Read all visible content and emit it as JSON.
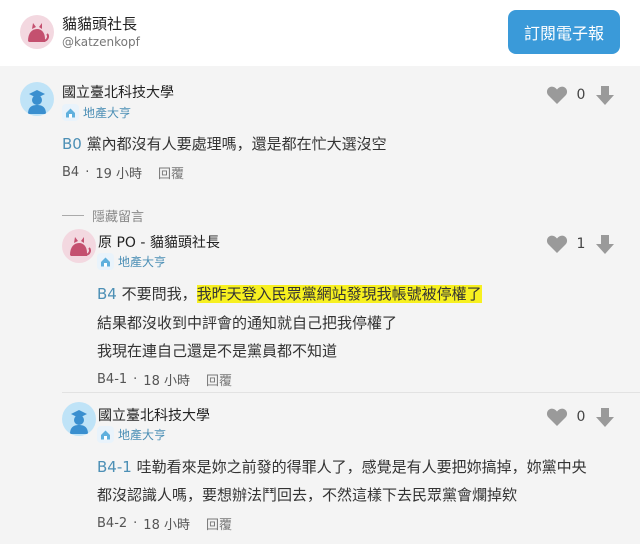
{
  "header": {
    "name": "貓貓頭社長",
    "handle": "@katzenkopf",
    "subscribe_label": "訂閱電子報"
  },
  "comments": [
    {
      "author": "國立臺北科技大學",
      "badge": "地產大亨",
      "floor_ref": "B0",
      "text": "黨內都沒有人要處理嗎，還是都在忙大選沒空",
      "floor": "B4",
      "time": "19 小時",
      "reply": "回覆",
      "likes": "0"
    }
  ],
  "hidden_label": "隱藏留言",
  "replies": [
    {
      "author": "原 PO - 貓貓頭社長",
      "badge": "地產大亨",
      "floor_ref": "B4",
      "text_pre": "不要問我，",
      "text_highlight": "我昨天登入民眾黨網站發現我帳號被停權了",
      "line2": "結果都沒收到中評會的通知就自己把我停權了",
      "line3": "我現在連自己還是不是黨員都不知道",
      "floor": "B4-1",
      "time": "18 小時",
      "reply": "回覆",
      "likes": "1"
    },
    {
      "author": "國立臺北科技大學",
      "badge": "地產大亨",
      "floor_ref": "B4-1",
      "text_line1": "哇勒看來是妳之前發的得罪人了，感覺是有人要把妳搞掉，妳黨中央",
      "text_line2": "都沒認識人嗎，要想辦法鬥回去，不然這樣下去民眾黨會爛掉欸",
      "floor": "B4-2",
      "time": "18 小時",
      "reply": "回覆",
      "likes": "0"
    }
  ],
  "colors": {
    "accent": "#3a9ad9",
    "highlight": "#f7f020",
    "floor_ref": "#4c8fb5",
    "feed_bg": "#f4f4f4"
  },
  "icons": [
    "cat-avatar",
    "student-avatar",
    "heart-icon",
    "arrow-down-icon",
    "house-badge-icon"
  ]
}
